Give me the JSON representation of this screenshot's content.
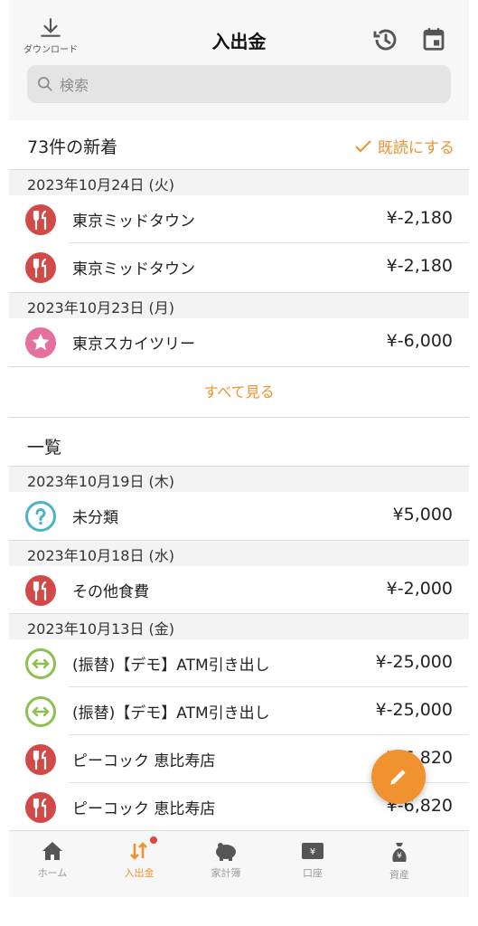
{
  "header": {
    "title": "入出金",
    "download_label": "ダウンロード",
    "search_placeholder": "検索"
  },
  "unread": {
    "title": "73件の新着",
    "mark_read": "既読にする",
    "see_all": "すべて見る",
    "groups": [
      {
        "date": "2023年10月24日 (火)",
        "items": [
          {
            "icon": "food-icon",
            "name": "東京ミッドタウン",
            "amount": "¥-2,180"
          },
          {
            "icon": "food-icon",
            "name": "東京ミッドタウン",
            "amount": "¥-2,180"
          }
        ]
      },
      {
        "date": "2023年10月23日 (月)",
        "items": [
          {
            "icon": "star-icon",
            "name": "東京スカイツリー",
            "amount": "¥-6,000"
          }
        ]
      }
    ]
  },
  "list": {
    "title": "一覧",
    "groups": [
      {
        "date": "2023年10月19日 (木)",
        "items": [
          {
            "icon": "question-icon",
            "name": "未分類",
            "amount": "¥5,000"
          }
        ]
      },
      {
        "date": "2023年10月18日 (水)",
        "items": [
          {
            "icon": "food-icon",
            "name": "その他食費",
            "amount": "¥-2,000"
          }
        ]
      },
      {
        "date": "2023年10月13日 (金)",
        "items": [
          {
            "icon": "transfer-icon",
            "name": "(振替)【デモ】ATM引き出し",
            "amount": "¥-25,000"
          },
          {
            "icon": "transfer-icon",
            "name": "(振替)【デモ】ATM引き出し",
            "amount": "¥-25,000"
          },
          {
            "icon": "food-icon",
            "name": "ピーコック 恵比寿店",
            "amount": "¥-6,820"
          },
          {
            "icon": "food-icon",
            "name": "ピーコック 恵比寿店",
            "amount": "¥-6,820"
          }
        ]
      }
    ]
  },
  "tabs": [
    {
      "label": "ホーム",
      "icon": "home-icon",
      "active": false
    },
    {
      "label": "入出金",
      "icon": "transactions-icon",
      "active": true
    },
    {
      "label": "家計簿",
      "icon": "piggy-bank-icon",
      "active": false
    },
    {
      "label": "口座",
      "icon": "account-icon",
      "active": false
    },
    {
      "label": "資産",
      "icon": "asset-bag-icon",
      "active": false
    }
  ],
  "colors": {
    "accent": "#f0922f",
    "food": "#d24a48",
    "star": "#e5709d",
    "uncategorized": "#4bb2c8",
    "transfer": "#8cc04f"
  }
}
